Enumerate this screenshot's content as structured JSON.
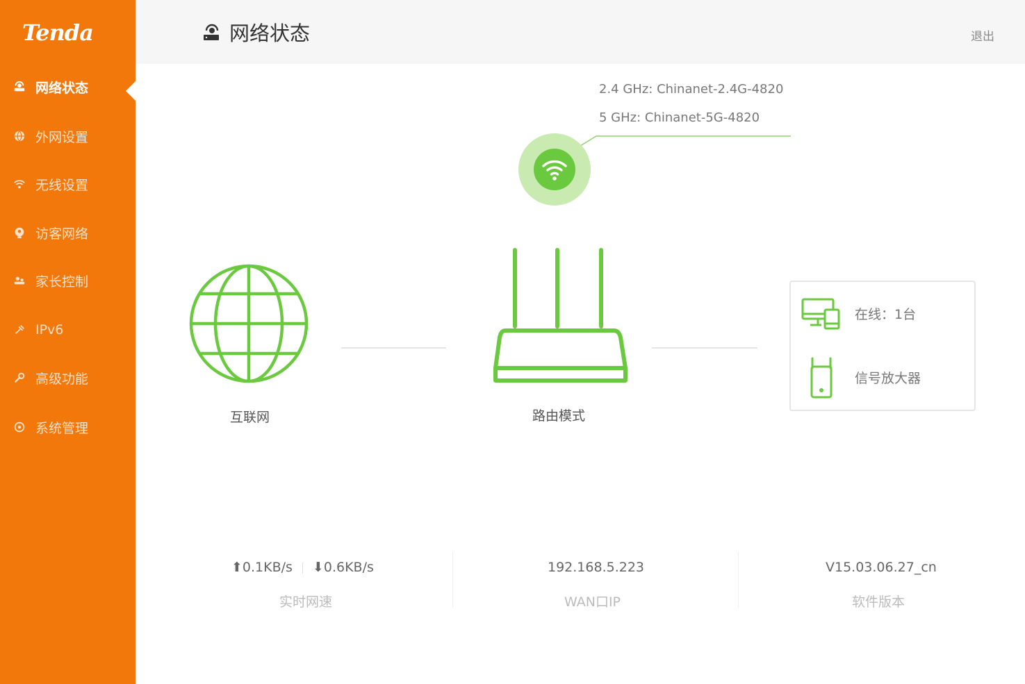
{
  "brand": {
    "logo_text": "Tenda"
  },
  "sidebar": {
    "items": [
      {
        "label": "网络状态",
        "icon": "router-icon",
        "active": true
      },
      {
        "label": "外网设置",
        "icon": "globe-icon",
        "active": false
      },
      {
        "label": "无线设置",
        "icon": "wifi-icon",
        "active": false
      },
      {
        "label": "访客网络",
        "icon": "guest-icon",
        "active": false
      },
      {
        "label": "家长控制",
        "icon": "parental-control-icon",
        "active": false
      },
      {
        "label": "IPv6",
        "icon": "ipv6-icon",
        "active": false
      },
      {
        "label": "高级功能",
        "icon": "wrench-icon",
        "active": false
      },
      {
        "label": "系统管理",
        "icon": "settings-icon",
        "active": false
      }
    ]
  },
  "header": {
    "title": "网络状态",
    "icon": "router-icon",
    "logout_label": "退出"
  },
  "topology": {
    "wifi": {
      "ssid_24": "2.4 GHz: Chinanet-2.4G-4820",
      "ssid_5": "5 GHz: Chinanet-5G-4820"
    },
    "internet_label": "互联网",
    "router_label": "路由模式",
    "devices": {
      "online_label": "在线：1台",
      "extender_label": "信号放大器"
    }
  },
  "stats": {
    "upload": "0.1KB/s",
    "download": "0.6KB/s",
    "speed_label": "实时网速",
    "wan_ip": "192.168.5.223",
    "wan_ip_label": "WAN口IP",
    "firmware": "V15.03.06.27_cn",
    "firmware_label": "软件版本"
  },
  "colors": {
    "brand_orange": "#f3780b",
    "accent_green": "#6ac93f",
    "light_green": "#c9eab0"
  }
}
